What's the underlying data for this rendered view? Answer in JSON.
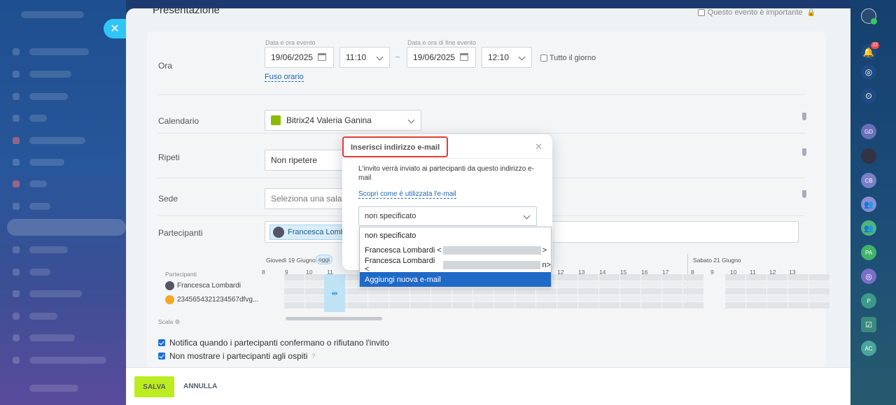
{
  "panel": {
    "title": "Presentazione",
    "important_label": "Questo evento è importante"
  },
  "form": {
    "time_label": "Ora",
    "start_label": "Data e ora evento",
    "end_label": "Data e ora di fine evento",
    "start_date": "19/06/2025",
    "start_time": "11:10",
    "end_date": "19/06/2025",
    "end_time": "12:10",
    "all_day_label": "Tutto il giorno",
    "timezone_link": "Fuso orario",
    "calendar_label": "Calendario",
    "calendar_value": "Bitrix24 Valeria Ganina",
    "repeat_label": "Ripeti",
    "repeat_value": "Non ripetere",
    "location_label": "Sede",
    "location_placeholder": "Seleziona una sala riu",
    "participants_label": "Partecipanti",
    "participant_chip": "Francesca Lombard"
  },
  "timeline": {
    "day1": "Giovedì 19 Giugno",
    "today_badge": "oggi",
    "day2": "Sabato 21 Giugno",
    "participants_header": "Partecipanti",
    "p1": "Francesca Lombardi",
    "p2": "2345654321234567dfvg...",
    "scale_label": "Scala",
    "hours_a": [
      "8",
      "9",
      "10",
      "11"
    ],
    "hours_b": [
      "12",
      "13",
      "14",
      "15",
      "16",
      "17"
    ],
    "hours_c": [
      "8",
      "9",
      "10",
      "11",
      "12",
      "13"
    ]
  },
  "options": {
    "notify": "Notifica quando i partecipanti confermano o rifiutano l'invito",
    "hide_participants": "Non mostrare i partecipanti agli ospiti"
  },
  "footer": {
    "save": "SALVA",
    "cancel": "ANNULLA"
  },
  "popup": {
    "title": "Inserisci indirizzo e-mail",
    "description": "L'invito verrà inviato ai partecipanti da questo indirizzo e-mail",
    "help_link": "Scopri come è utilizzata l'e-mail",
    "selected": "non specificato",
    "options": [
      "non specificato",
      "Francesca Lombardi <",
      "Francesca Lombardi <",
      "Aggiungi nuova e-mail"
    ],
    "option_suffixes": [
      ">",
      "n>"
    ]
  },
  "right_bar": {
    "notifications_count": "22",
    "avatars": [
      "GD",
      "CB",
      "PA",
      "P",
      "AC"
    ]
  },
  "colors": {
    "accent_blue": "#2fc6f6",
    "save_green": "#bbed21",
    "highlight_red": "#e53935",
    "dropdown_selected": "#1f69c7"
  }
}
